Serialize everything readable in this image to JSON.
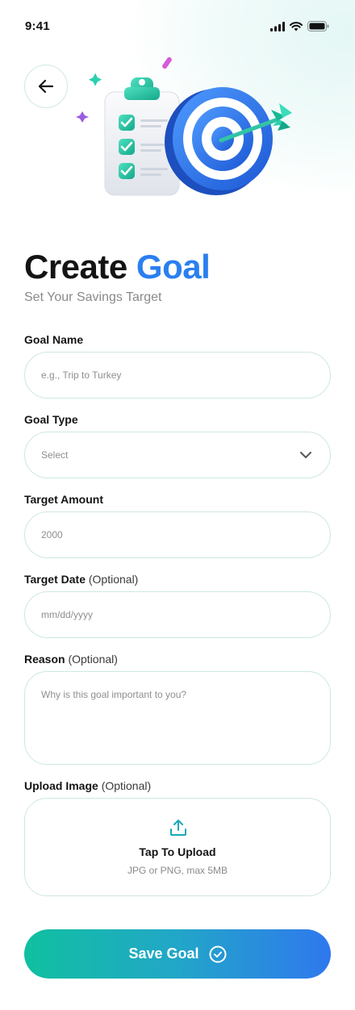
{
  "status_bar": {
    "time": "9:41"
  },
  "icons": {
    "back": "arrow-left-icon",
    "signal": "cellular-signal-icon",
    "wifi": "wifi-icon",
    "battery": "battery-icon",
    "dropdown": "chevron-down-icon",
    "upload": "upload-icon",
    "save": "check-circle-icon"
  },
  "colors": {
    "accent_blue": "#2a7ff0",
    "teal": "#10c0a0",
    "border": "#cde8e2"
  },
  "header": {
    "title_main": "Create",
    "title_accent": "Goal",
    "subtitle": "Set Your Savings Target"
  },
  "form": {
    "goal_name": {
      "label": "Goal Name",
      "placeholder": "e.g., Trip to Turkey"
    },
    "goal_type": {
      "label": "Goal Type",
      "value": "Select"
    },
    "target_amount": {
      "label": "Target Amount",
      "placeholder": "2000"
    },
    "target_date": {
      "label": "Target Date",
      "optional": "(Optional)",
      "placeholder": "mm/dd/yyyy"
    },
    "reason": {
      "label": "Reason",
      "optional": "(Optional)",
      "placeholder": "Why is this goal important to you?"
    },
    "upload_image": {
      "label": "Upload Image",
      "optional": "(Optional)",
      "title": "Tap To Upload",
      "hint": "JPG or PNG, max 5MB"
    }
  },
  "actions": {
    "save_label": "Save Goal"
  }
}
